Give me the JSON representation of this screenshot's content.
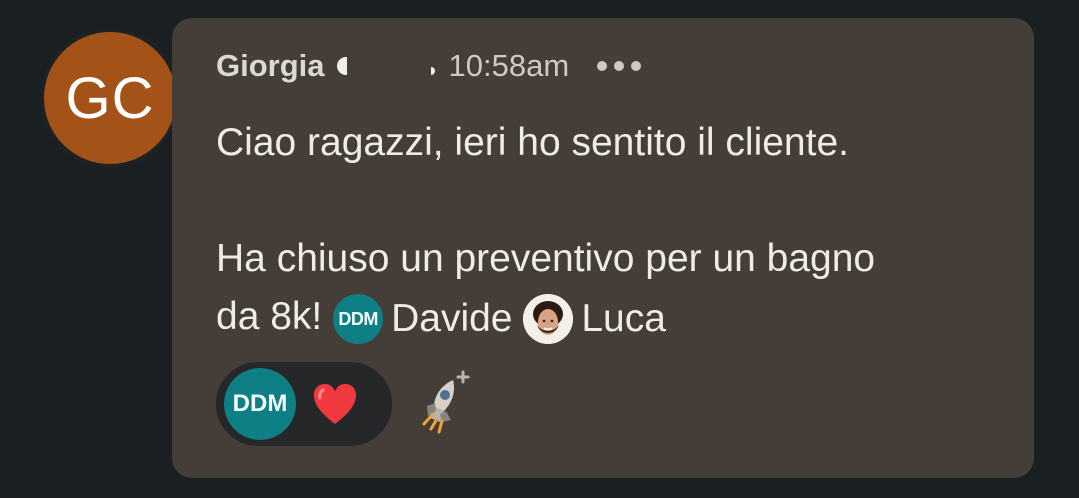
{
  "message": {
    "avatar_initials": "GC",
    "sender": "Giorgia",
    "time": "10:58am",
    "body_line_1": "Ciao ragazzi, ieri ho sentito il cliente.",
    "body_line_2_prefix": "Ha chiuso un preventivo per un bagno",
    "body_line_3_prefix": "da 8k!",
    "mentions": [
      {
        "avatar_initials": "DDM",
        "name": "Davide"
      },
      {
        "name": "Luca"
      }
    ],
    "reactions": [
      {
        "avatar_initials": "DDM"
      }
    ]
  },
  "colors": {
    "background": "#1a1f21",
    "bubble": "#443d38",
    "sender_avatar": "#a35317",
    "mention_avatar": "#0f7f86",
    "reaction_pill": "#252728"
  },
  "icons": {
    "more": "more-horizontal-icon",
    "reaction": "heart-icon",
    "add_reaction": "rocket-plus-icon"
  }
}
